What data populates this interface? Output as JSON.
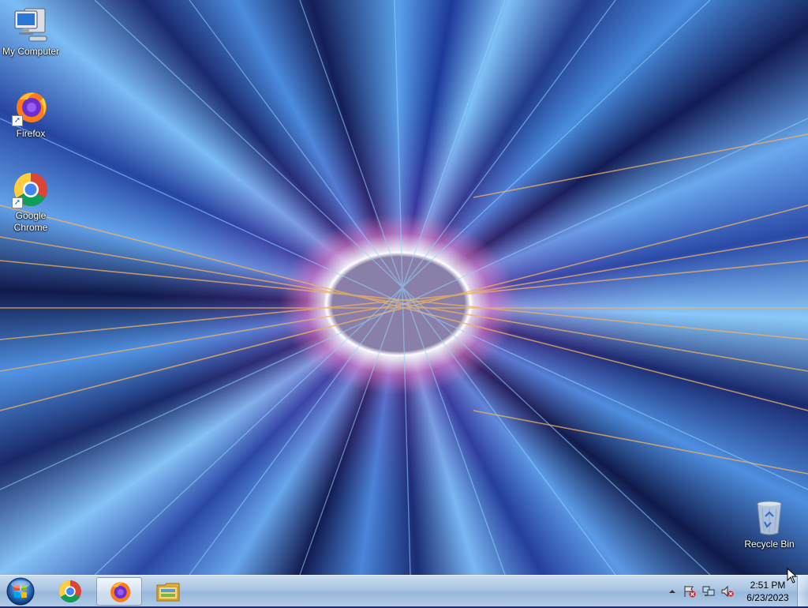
{
  "desktop": {
    "icons": [
      {
        "label": "My Computer"
      },
      {
        "label": "Firefox"
      },
      {
        "label": "Google Chrome"
      },
      {
        "label": "Recycle Bin"
      }
    ]
  },
  "taskbar": {
    "pinned": [
      "start-orb-icon",
      "chrome-icon",
      "firefox-icon",
      "file-explorer-icon"
    ],
    "clock": {
      "time": "2:51 PM",
      "date": "6/23/2023"
    }
  },
  "colors": {
    "taskbar": "#a9c4e2",
    "accent": "#1a5fc8"
  }
}
